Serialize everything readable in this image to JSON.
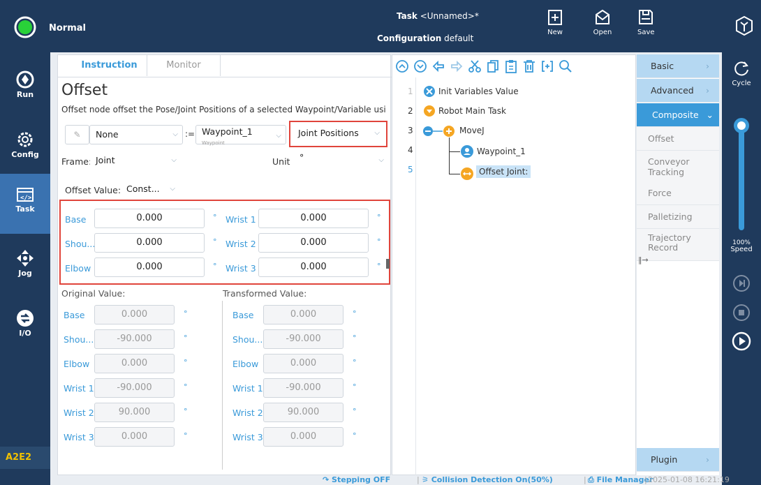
{
  "status": {
    "mode": "Normal"
  },
  "task": {
    "task_label": "Task",
    "task_name": "<Unnamed>*",
    "config_label": "Configuration",
    "config_name": "default"
  },
  "toolbar": {
    "new": "New",
    "open": "Open",
    "save": "Save"
  },
  "nav": [
    {
      "label": "Run"
    },
    {
      "label": "Config"
    },
    {
      "label": "Task"
    },
    {
      "label": "Jog"
    },
    {
      "label": "I/O"
    }
  ],
  "footer_code": "A2E2",
  "tabs": {
    "instruction": "Instruction",
    "monitor": "Monitor"
  },
  "node": {
    "title": "Offset",
    "desc": "Offset node offset the Pose/Joint Positions of a selected Waypoint/Variable usi"
  },
  "row1": {
    "none": "None",
    "assign": ":=",
    "waypoint": "Waypoint_1",
    "waypoint_sub": "Waypoint",
    "type": "Joint Positions"
  },
  "frame": {
    "label": "Frame:",
    "value": "Joint",
    "unit_label": "Unit",
    "unit_value": "°"
  },
  "offset_value": {
    "label": "Offset Value:",
    "value": "Const..."
  },
  "offset": {
    "left": [
      {
        "name": "Base",
        "value": "0.000"
      },
      {
        "name": "Shou...",
        "value": "0.000"
      },
      {
        "name": "Elbow",
        "value": "0.000"
      }
    ],
    "right": [
      {
        "name": "Wrist 1",
        "value": "0.000"
      },
      {
        "name": "Wrist 2",
        "value": "0.000"
      },
      {
        "name": "Wrist 3",
        "value": "0.000"
      }
    ],
    "unit": "°"
  },
  "original": {
    "title": "Original Value:",
    "rows": [
      {
        "name": "Base",
        "value": "0.000"
      },
      {
        "name": "Shou...",
        "value": "-90.000"
      },
      {
        "name": "Elbow",
        "value": "0.000"
      },
      {
        "name": "Wrist 1",
        "value": "-90.000"
      },
      {
        "name": "Wrist 2",
        "value": "90.000"
      },
      {
        "name": "Wrist 3",
        "value": "0.000"
      }
    ]
  },
  "transformed": {
    "title": "Transformed Value:",
    "rows": [
      {
        "name": "Base",
        "value": "0.000"
      },
      {
        "name": "Shou...",
        "value": "-90.000"
      },
      {
        "name": "Elbow",
        "value": "0.000"
      },
      {
        "name": "Wrist 1",
        "value": "-90.000"
      },
      {
        "name": "Wrist 2",
        "value": "90.000"
      },
      {
        "name": "Wrist 3",
        "value": "0.000"
      }
    ]
  },
  "tree": {
    "lines": [
      "1",
      "2",
      "3",
      "4",
      "5"
    ],
    "items": [
      "Init Variables Value",
      "Robot Main Task",
      "MoveJ",
      "Waypoint_1",
      "Offset Joint:"
    ]
  },
  "library": {
    "basic": "Basic",
    "advanced": "Advanced",
    "composite": "Composite",
    "items": [
      "Offset",
      "Conveyor Tracking",
      "Force",
      "Palletizing",
      "Trajectory Record"
    ],
    "plugin": "Plugin"
  },
  "rightbar": {
    "cycle": "Cycle",
    "speed_pct": "100%",
    "speed": "Speed"
  },
  "statusbar": {
    "stepping": "Stepping OFF",
    "collision": "Collision Detection On(50%)",
    "file_manager": "File Manager",
    "datetime": "2025-01-08 16:21:19"
  },
  "colors": {
    "navy": "#1f3a5c",
    "accent": "#3a9ad9",
    "highlight": "#e0443b",
    "orange": "#f5a623"
  }
}
